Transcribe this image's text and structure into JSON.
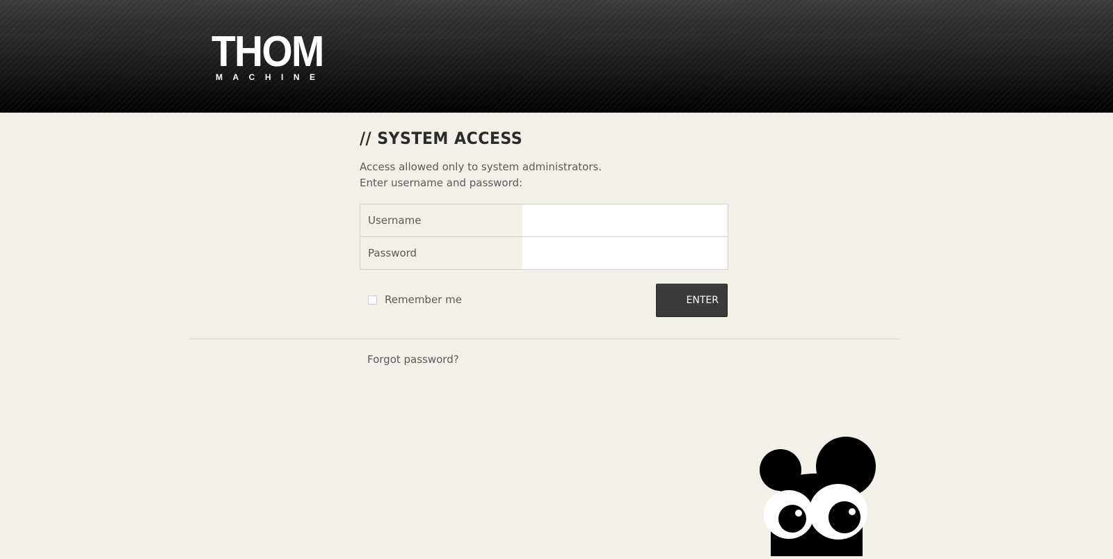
{
  "header": {
    "logo_main": "THOM",
    "logo_sub": "MACHINE"
  },
  "login": {
    "title": "// SYSTEM ACCESS",
    "description_line1": "Access allowed only to system administrators.",
    "description_line2": "Enter username and password:",
    "username_label": "Username",
    "username_value": "",
    "password_label": "Password",
    "password_value": "",
    "remember_label": "Remember me",
    "remember_checked": false,
    "enter_label": "ENTER",
    "forgot_label": "Forgot password?"
  },
  "colors": {
    "background": "#f3f0ea",
    "header_dark": "#000000",
    "button": "#3c3b3b",
    "text": "#5a5a5a",
    "title": "#2b2b2b"
  },
  "mascot": {
    "icon": "mascot-character-icon"
  }
}
